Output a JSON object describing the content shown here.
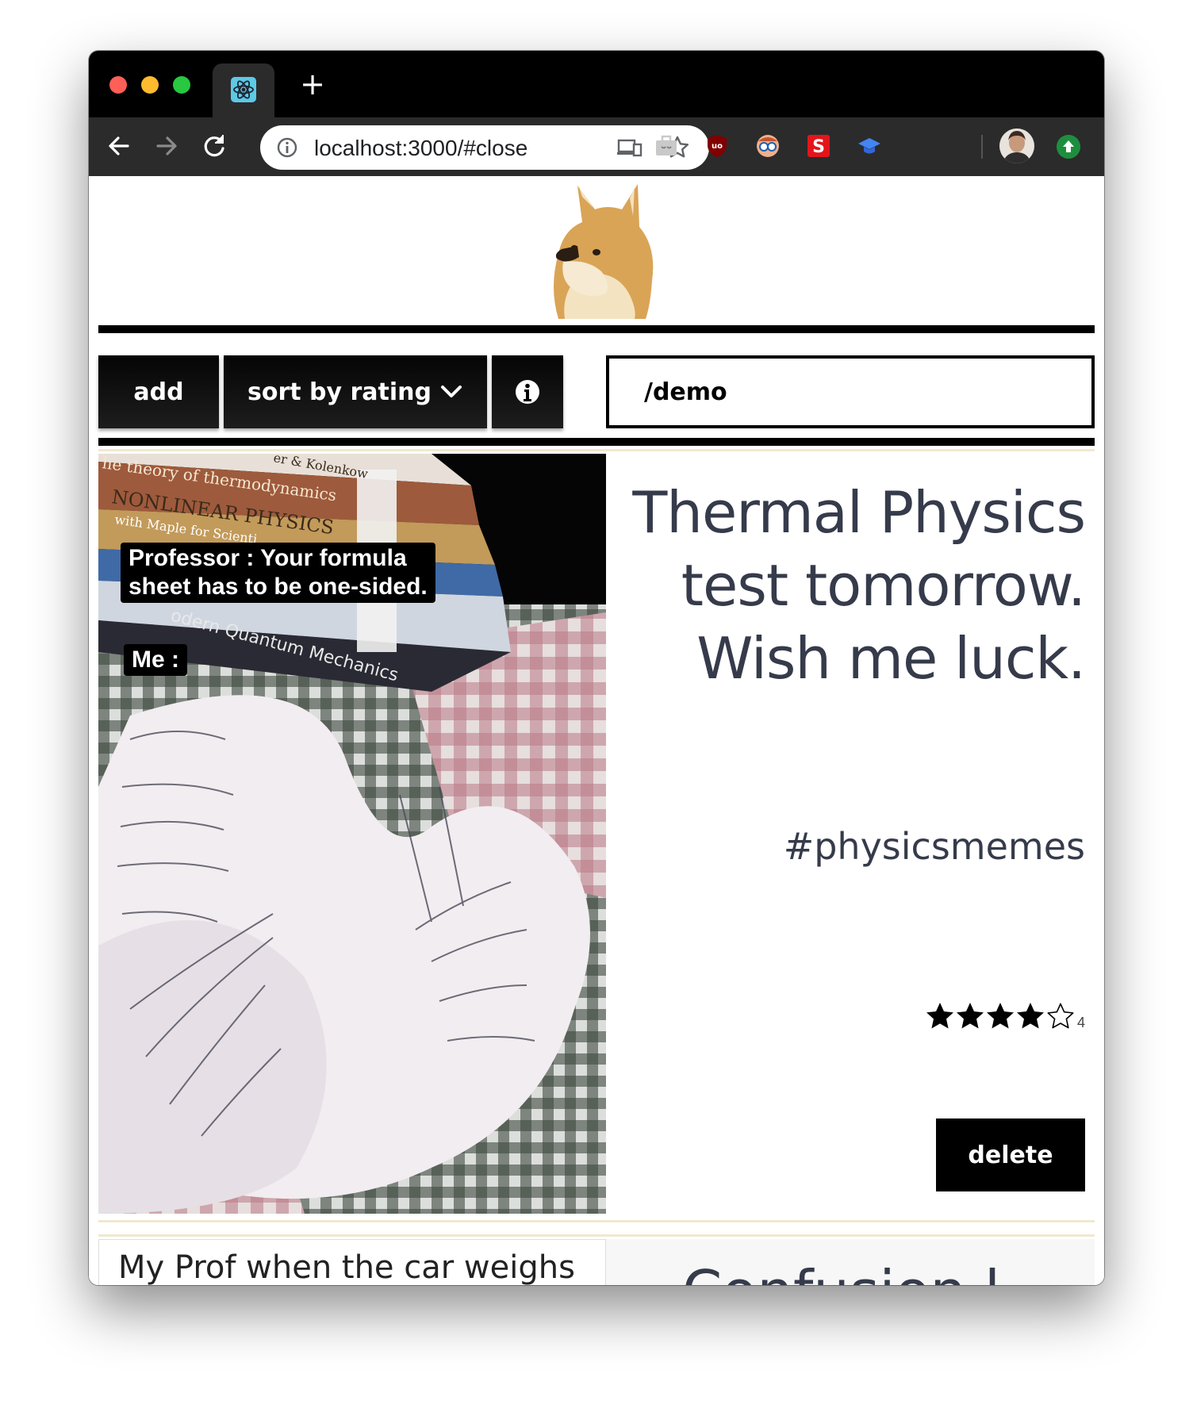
{
  "browser": {
    "url": "localhost:3000/#close",
    "new_tab_label": "+",
    "tab_icon": "react-icon",
    "nav": {
      "back": "back-arrow-icon",
      "forward": "forward-arrow-icon",
      "reload": "reload-icon"
    },
    "extensions": [
      "briefcase-icon",
      "ublock-icon",
      "glasses-icon",
      "s-extension-icon",
      "graduation-cap-icon"
    ]
  },
  "toolbar": {
    "add_label": "add",
    "sort_label": "sort by rating",
    "search_value": "/demo"
  },
  "meme": {
    "caption_professor_line1": "Professor : Your formula",
    "caption_professor_line2": "sheet has to be one-sided.",
    "caption_me": "Me :",
    "title_line1": "Thermal Physics",
    "title_line2": "test tomorrow.",
    "title_line3": "Wish me luck.",
    "tag": "#physicsmemes",
    "rating": 4,
    "rating_max": 5,
    "rating_label": "4",
    "delete_label": "delete",
    "book_spines": [
      "he theory of thermodynamics",
      "NONLINEAR PHYSICS",
      "with Maple for Scienti",
      "odern Quantum Mechanics",
      "er & Kolenkow"
    ]
  },
  "next_card": {
    "caption": "My Prof when the car weighs",
    "title_partial": "Confusion l"
  },
  "colors": {
    "title": "#363b4b",
    "rule": "#000000",
    "divider": "#f1e8cf"
  }
}
